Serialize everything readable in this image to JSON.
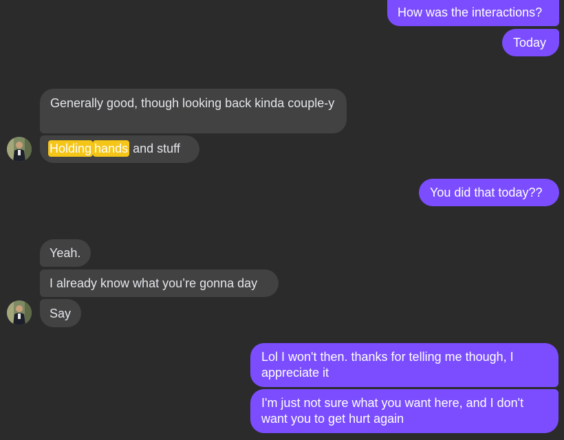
{
  "messages": {
    "m1": "How was the interactions?",
    "m2": "Today",
    "m3": "Generally good, though looking back kinda couple-y",
    "m4_hl1": "Holding",
    "m4_hl2": "hands",
    "m4_rest": "and stuff",
    "m5": "You did that today??",
    "m6": "Yeah.",
    "m7": "I already know what you’re gonna day",
    "m8": "Say",
    "m9": "Lol I won't then. thanks for telling me though, I appreciate it",
    "m10": "I'm just not sure what you want here, and I don't want you to get hurt again"
  },
  "colors": {
    "background": "#2b2b2b",
    "outgoing_bubble": "#7b4dff",
    "incoming_bubble": "#424242",
    "highlight": "#f5c518"
  },
  "icons": {
    "avatar": "contact-avatar-icon"
  }
}
